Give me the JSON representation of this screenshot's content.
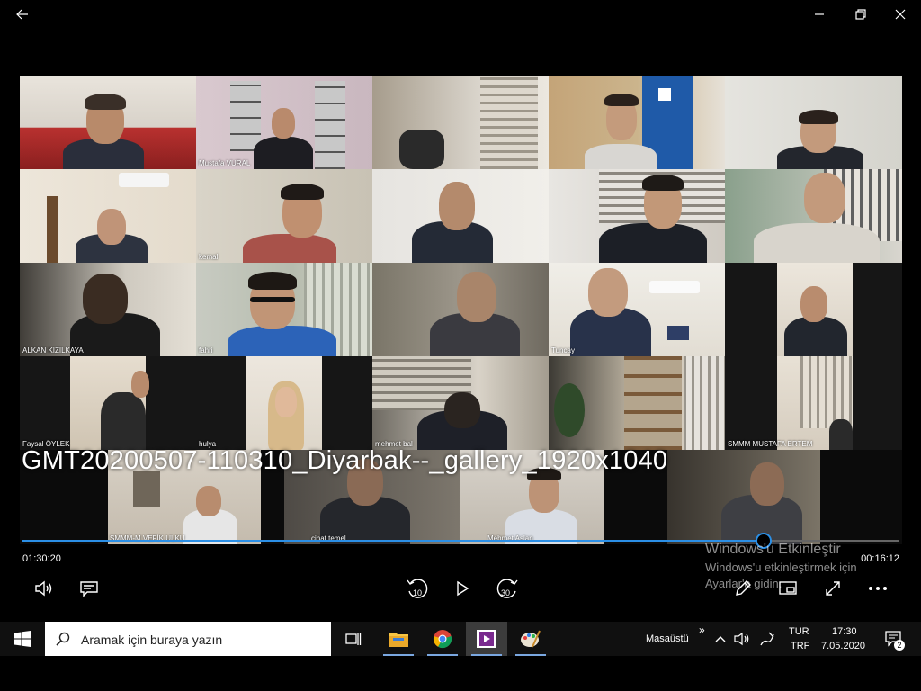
{
  "window": {
    "back_icon": "back-arrow-icon",
    "minimize_icon": "minimize-icon",
    "restore_icon": "restore-icon",
    "close_icon": "close-icon"
  },
  "video": {
    "title": "GMT20200507-110310_Diyarbak--_gallery_1920x1040",
    "participants": [
      "Mustafa VURAL",
      "kemal",
      "ALKAN KIZILKAYA",
      "fahri",
      "Tuncay",
      "Faysal ÖYLEK",
      "hulya",
      "mehmet bal",
      "SMMM MUSTAFA ERTEM",
      "SMMM-M.VEFİK ULKU",
      "cihat temel",
      "Mehmet Aslan"
    ]
  },
  "player": {
    "time_elapsed": "01:30:20",
    "time_remaining": "00:16:12",
    "progress": 0.846,
    "controls": [
      "volume-icon",
      "subtitles-icon",
      "rewind-10-icon",
      "play-icon",
      "forward-30-icon",
      "edit-pen-icon",
      "miniview-icon",
      "fullscreen-icon",
      "more-icon"
    ],
    "rewind_label": "10",
    "forward_label": "30"
  },
  "watermark": {
    "line1": "Windows'u Etkinleştir",
    "line2": "Windows'u etkinleştirmek için",
    "line3": "Ayarlar'a gidin."
  },
  "taskbar": {
    "search_placeholder": "Aramak için buraya yazın",
    "desktop_label": "Masaüstü",
    "lang_top": "TUR",
    "lang_bottom": "TRF",
    "time": "17:30",
    "date": "7.05.2020",
    "notification_count": "2",
    "colors": {
      "taskbar": "#101010",
      "accent": "#2b8fe6"
    }
  }
}
